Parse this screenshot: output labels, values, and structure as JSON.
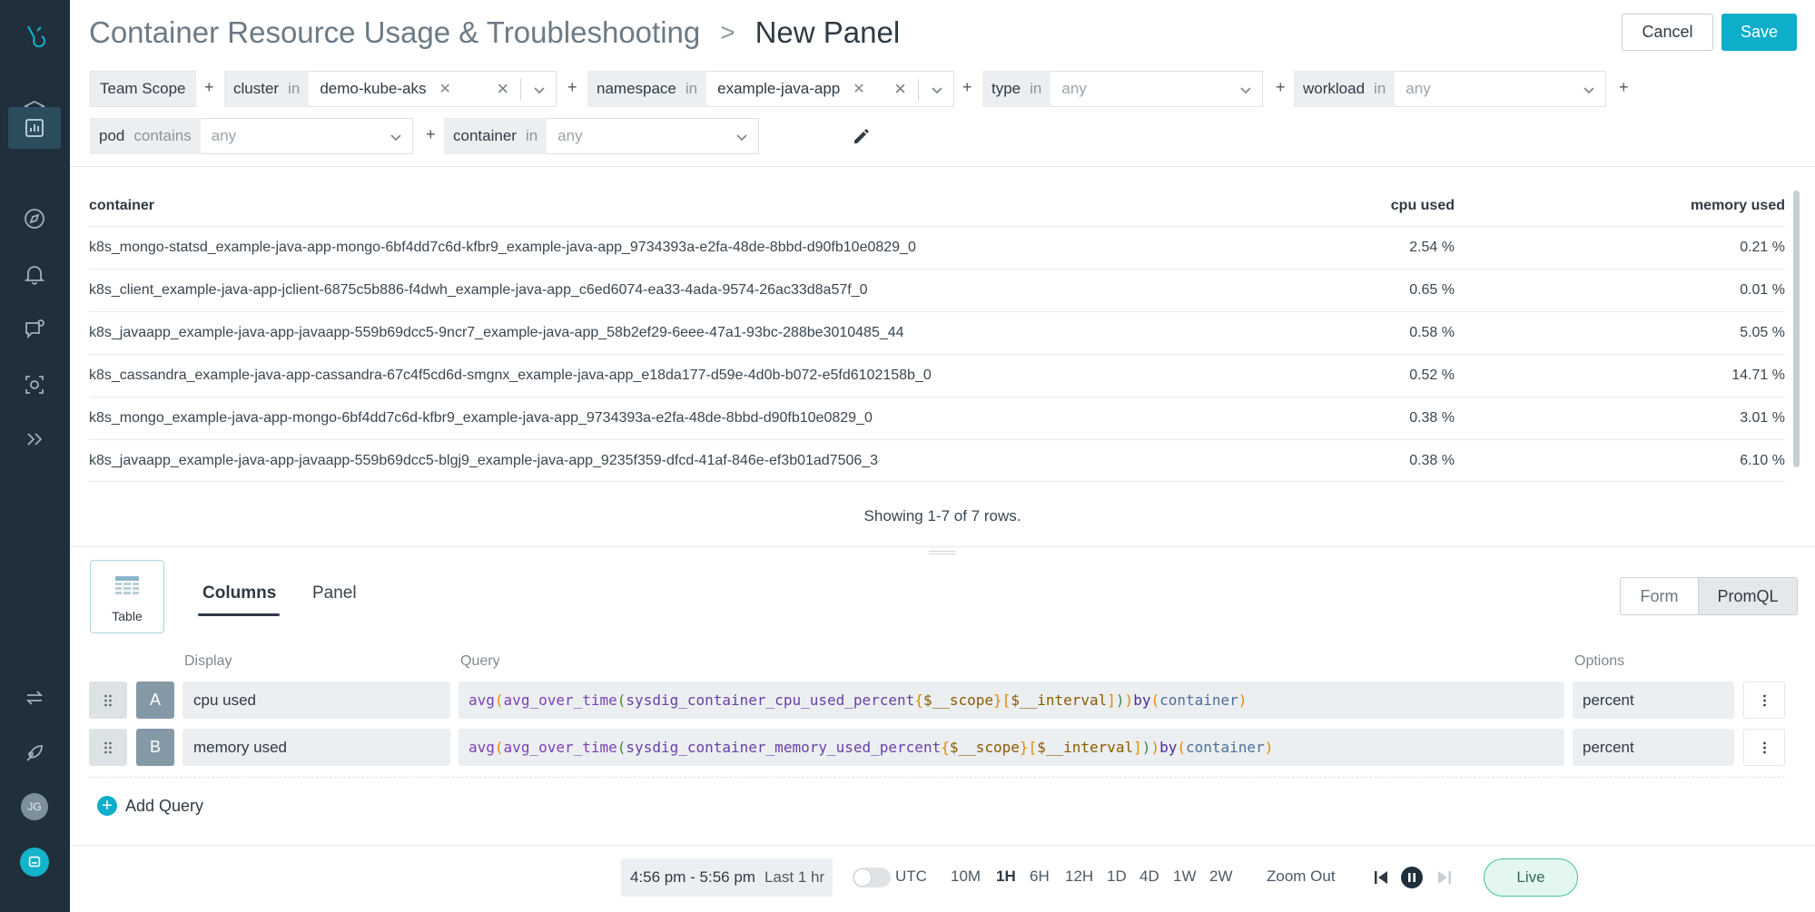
{
  "header": {
    "dashboard_title": "Container Resource Usage & Troubleshooting",
    "separator": ">",
    "panel_title": "New Panel",
    "cancel_label": "Cancel",
    "save_label": "Save"
  },
  "scope": {
    "team_scope": "Team Scope",
    "plus": "+",
    "filters": [
      {
        "label": "cluster",
        "op": "in",
        "value": "demo-kube-aks"
      },
      {
        "label": "namespace",
        "op": "in",
        "value": "example-java-app"
      },
      {
        "label": "type",
        "op": "in",
        "value": "any"
      },
      {
        "label": "workload",
        "op": "in",
        "value": "any"
      },
      {
        "label": "pod",
        "op": "contains",
        "value": "any"
      },
      {
        "label": "container",
        "op": "in",
        "value": "any"
      }
    ]
  },
  "table": {
    "headers": [
      "container",
      "cpu used",
      "memory used"
    ],
    "rows": [
      {
        "container": "k8s_mongo-statsd_example-java-app-mongo-6bf4dd7c6d-kfbr9_example-java-app_9734393a-e2fa-48de-8bbd-d90fb10e0829_0",
        "cpu": "2.54 %",
        "memory": "0.21 %"
      },
      {
        "container": "k8s_client_example-java-app-jclient-6875c5b886-f4dwh_example-java-app_c6ed6074-ea33-4ada-9574-26ac33d8a57f_0",
        "cpu": "0.65 %",
        "memory": "0.01 %"
      },
      {
        "container": "k8s_javaapp_example-java-app-javaapp-559b69dcc5-9ncr7_example-java-app_58b2ef29-6eee-47a1-93bc-288be3010485_44",
        "cpu": "0.58 %",
        "memory": "5.05 %"
      },
      {
        "container": "k8s_cassandra_example-java-app-cassandra-67c4f5cd6d-smgnx_example-java-app_e18da177-d59e-4d0b-b072-e5fd6102158b_0",
        "cpu": "0.52 %",
        "memory": "14.71 %"
      },
      {
        "container": "k8s_mongo_example-java-app-mongo-6bf4dd7c6d-kfbr9_example-java-app_9734393a-e2fa-48de-8bbd-d90fb10e0829_0",
        "cpu": "0.38 %",
        "memory": "3.01 %"
      },
      {
        "container": "k8s_javaapp_example-java-app-javaapp-559b69dcc5-blgj9_example-java-app_9235f359-dfcd-41af-846e-ef3b01ad7506_3",
        "cpu": "0.38 %",
        "memory": "6.10 %"
      }
    ],
    "showing": "Showing 1-7 of 7 rows."
  },
  "editor": {
    "viz_label": "Table",
    "tabs": {
      "columns": "Columns",
      "panel": "Panel"
    },
    "modes": {
      "form": "Form",
      "promql": "PromQL"
    },
    "col_headers": {
      "display": "Display",
      "query": "Query",
      "options": "Options"
    },
    "queries": [
      {
        "letter": "A",
        "display": "cpu used",
        "metric": "sysdig_container_cpu_used_percent",
        "option": "percent"
      },
      {
        "letter": "B",
        "display": "memory used",
        "metric": "sysdig_container_memory_used_percent",
        "option": "percent"
      }
    ],
    "query_parts": {
      "avg": "avg",
      "avg_over_time": "avg_over_time",
      "scope_var": "$__scope",
      "interval_var": "$__interval",
      "by": "by",
      "label": "container"
    },
    "add_query": "Add Query"
  },
  "footer": {
    "time_range": "4:56 pm - 5:56 pm",
    "last": "Last 1 hr",
    "utc": "UTC",
    "ranges": [
      "10M",
      "1H",
      "6H",
      "12H",
      "1D",
      "4D",
      "1W",
      "2W"
    ],
    "selected_range": "1H",
    "zoom_out": "Zoom Out",
    "live": "Live"
  },
  "sidebar": {
    "avatar_initials": "JG",
    "icons": [
      "logo-icon",
      "layers-icon",
      "dashboard-icon",
      "explore-icon",
      "alerts-icon",
      "events-icon",
      "capture-icon",
      "expand-icon",
      "integrations-icon",
      "get-started-icon"
    ]
  },
  "colors": {
    "sidebar_bg": "#1f2f3b",
    "accent": "#0eaecb",
    "live_border": "#42c199"
  }
}
